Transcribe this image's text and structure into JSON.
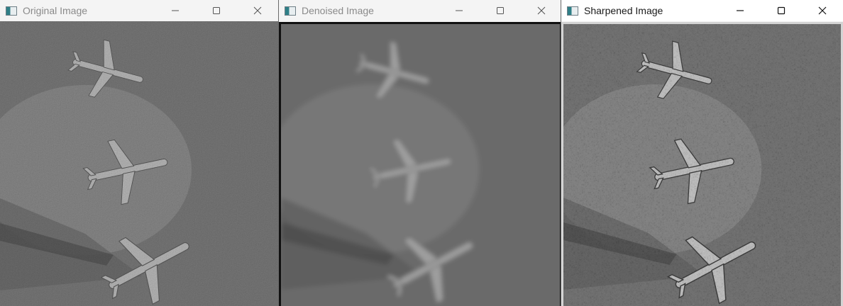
{
  "windows": [
    {
      "title": "Original Image",
      "state": "inactive",
      "controls": [
        "minimize",
        "maximize",
        "close"
      ]
    },
    {
      "title": "Denoised Image",
      "state": "inactive",
      "controls": [
        "minimize",
        "maximize",
        "close"
      ]
    },
    {
      "title": "Sharpened Image",
      "state": "active",
      "controls": [
        "minimize",
        "maximize",
        "close"
      ]
    }
  ],
  "icons": {
    "app": "opencv-window-icon",
    "minimize": "minimize-icon",
    "maximize": "maximize-icon",
    "close": "close-icon"
  },
  "image_content": "grayscale aerial photo of three airplanes on tarmac"
}
